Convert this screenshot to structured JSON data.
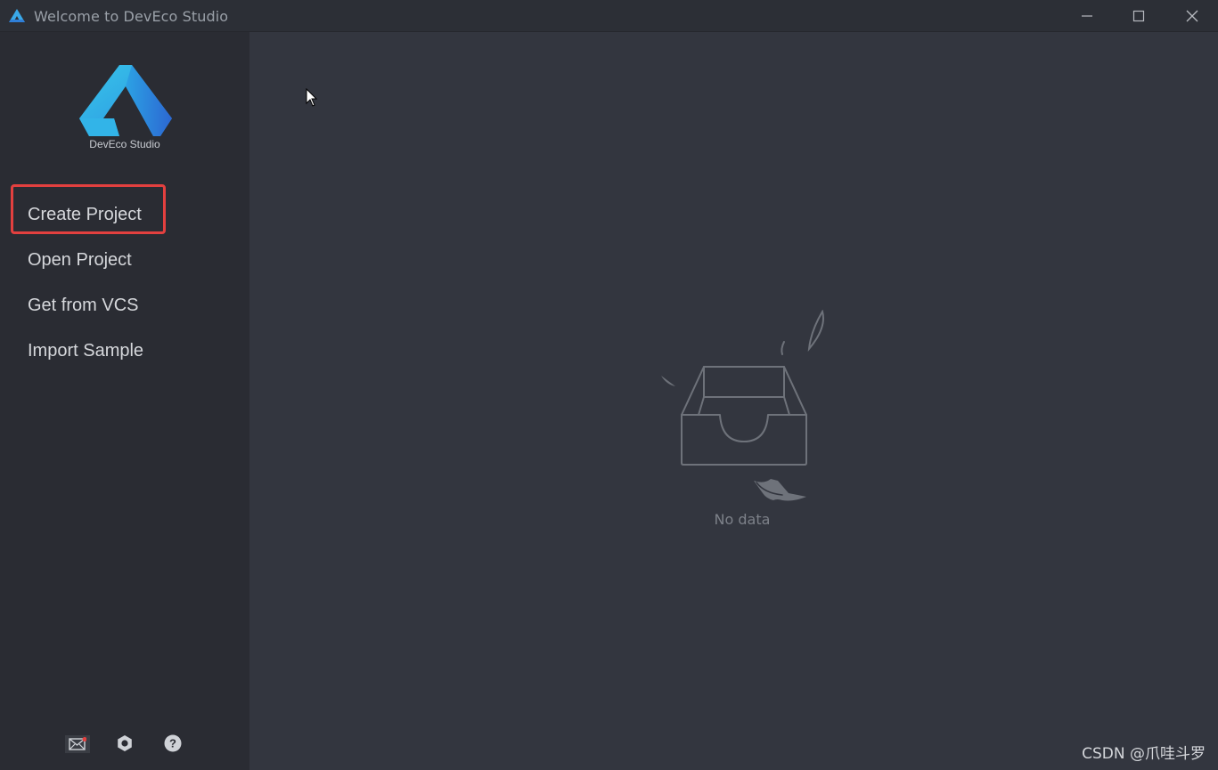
{
  "window": {
    "title": "Welcome to DevEco Studio"
  },
  "sidebar": {
    "logo_label": "DevEco Studio",
    "items": [
      {
        "label": "Create Project"
      },
      {
        "label": "Open Project"
      },
      {
        "label": "Get from VCS"
      },
      {
        "label": "Import Sample"
      }
    ],
    "bottom_icons": [
      "mail-icon",
      "gear-icon",
      "help-icon"
    ]
  },
  "main": {
    "empty_text": "No data"
  },
  "watermark": "CSDN @爪哇斗罗",
  "colors": {
    "sidebar_bg": "#2a2c33",
    "main_bg": "#33363f",
    "highlight": "#e3403f",
    "logo_light": "#34c0e8",
    "logo_dark": "#2e6fd8"
  }
}
